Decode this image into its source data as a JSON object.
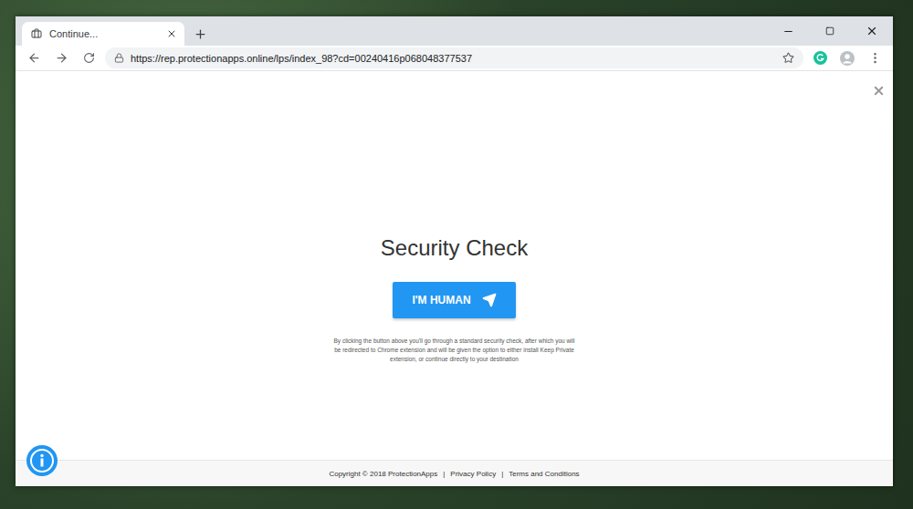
{
  "window": {
    "title": "Continue..."
  },
  "tabs": [
    {
      "label": "Continue...",
      "selected": true
    }
  ],
  "address_bar": {
    "url": "https://rep.protectionapps.online/lps/index_98?cd=00240416p068048377537",
    "secure": true
  },
  "page": {
    "heading": "Security Check",
    "button": "I'M HUMAN",
    "notice": "By clicking the button above you'll go through a standard security check, after which you will be redirected to Chrome extension and will be given the option to either install Keep Private extension, or continue directly to your destination"
  },
  "footer": {
    "copyright": "Copyright © 2018 ProtectionApps",
    "separator": "|",
    "links": [
      "Privacy Policy",
      "Terms and Conditions"
    ]
  }
}
